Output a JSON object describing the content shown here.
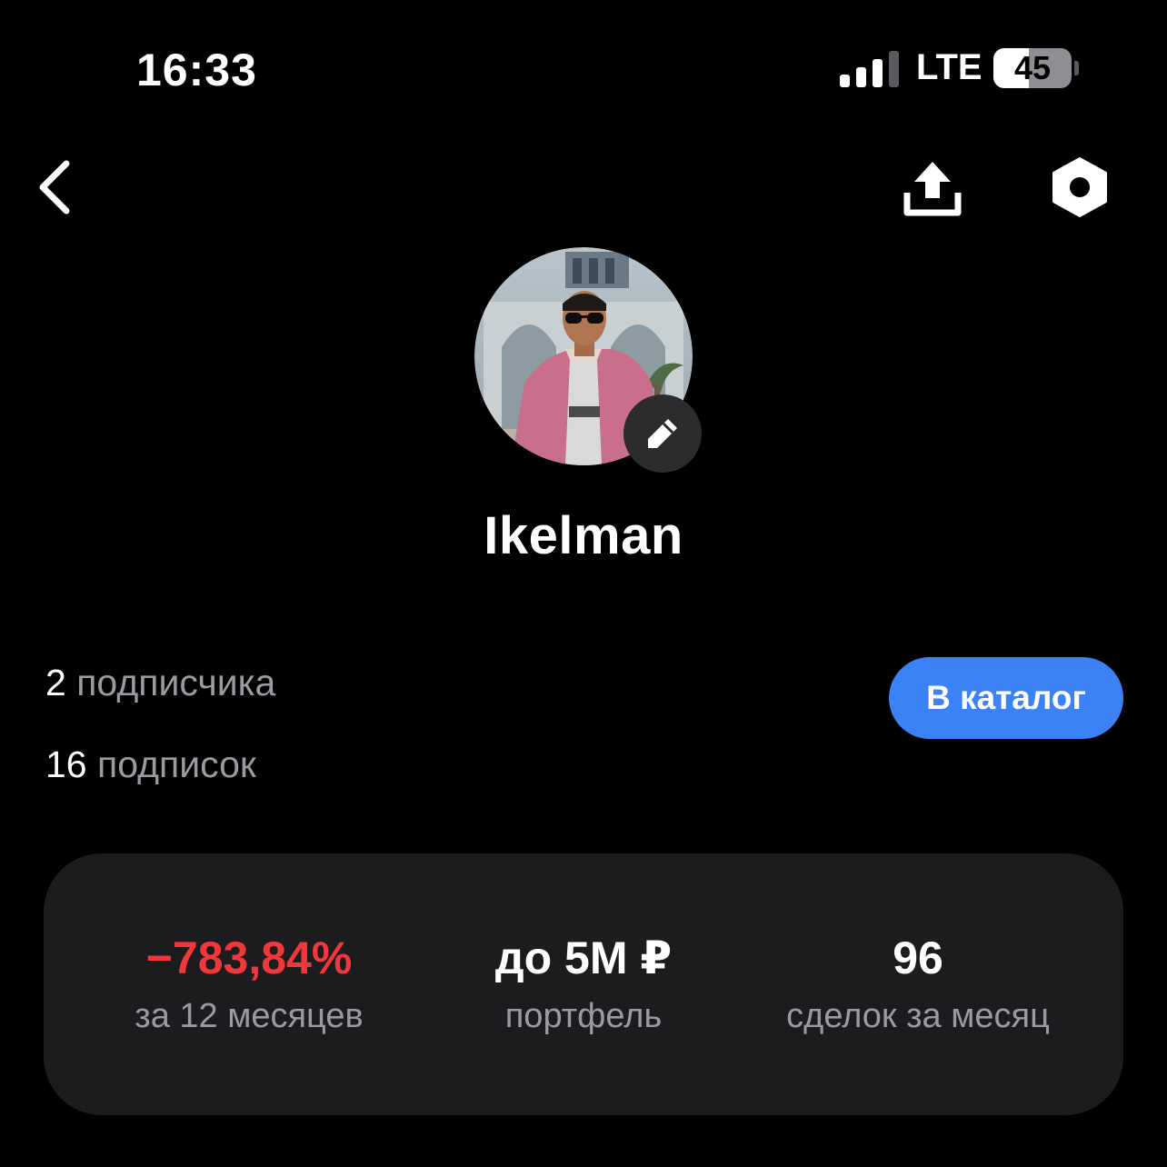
{
  "status_bar": {
    "time": "16:33",
    "network": "LTE",
    "battery_percent": "45",
    "battery_level": 0.45,
    "signal_bars_active": 3,
    "signal_bars_total": 4
  },
  "nav": {
    "back_icon": "chevron-left-icon",
    "share_icon": "share-upload-icon",
    "settings_icon": "settings-hexagon-icon"
  },
  "profile": {
    "avatar_icon": "user-photo",
    "edit_icon": "pencil-icon",
    "username": "Ikelman"
  },
  "followers": {
    "subscribers_count": "2",
    "subscribers_label": "подписчика",
    "subscriptions_count": "16",
    "subscriptions_label": "подписок"
  },
  "catalog_button": {
    "label": "В каталог"
  },
  "stats": [
    {
      "value": "−783,84%",
      "label": "за 12 месяцев",
      "color": "#f0383b"
    },
    {
      "value": "до 5M ₽",
      "label": "портфель",
      "color": "#ffffff"
    },
    {
      "value": "96",
      "label": "сделок за месяц",
      "color": "#ffffff"
    }
  ],
  "colors": {
    "background": "#000000",
    "card": "#1c1c1e",
    "accent_blue": "#3b82f6",
    "negative_red": "#f0383b",
    "secondary_text": "#9a9aa0"
  }
}
